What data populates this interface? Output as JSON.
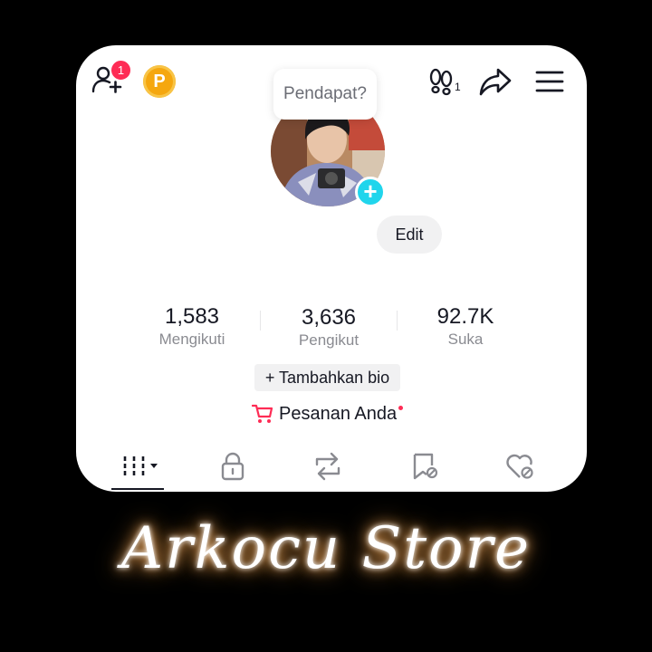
{
  "header": {
    "friend_badge": "1",
    "coin_letter": "P",
    "footprint_count": "1",
    "icons": [
      "add-friend-icon",
      "coin-icon",
      "footprints-icon",
      "share-icon",
      "menu-icon"
    ]
  },
  "profile": {
    "opinion_bubble": "Pendapat?",
    "edit_label": "Edit"
  },
  "stats": [
    {
      "value": "1,583",
      "label": "Mengikuti"
    },
    {
      "value": "3,636",
      "label": "Pengikut"
    },
    {
      "value": "92.7K",
      "label": "Suka"
    }
  ],
  "bio": {
    "add_label": "+ Tambahkan bio"
  },
  "orders": {
    "label": "Pesanan Anda",
    "icon": "cart-icon",
    "accent": "#fe2c55"
  },
  "tabs": [
    "videos-grid-icon",
    "lock-icon",
    "repost-icon",
    "favorites-icon",
    "liked-icon"
  ],
  "brand": {
    "text": "Arkocu Store"
  },
  "colors": {
    "accent": "#fe2c55",
    "plus": "#20d5ec",
    "coin": "#f5a70f"
  }
}
